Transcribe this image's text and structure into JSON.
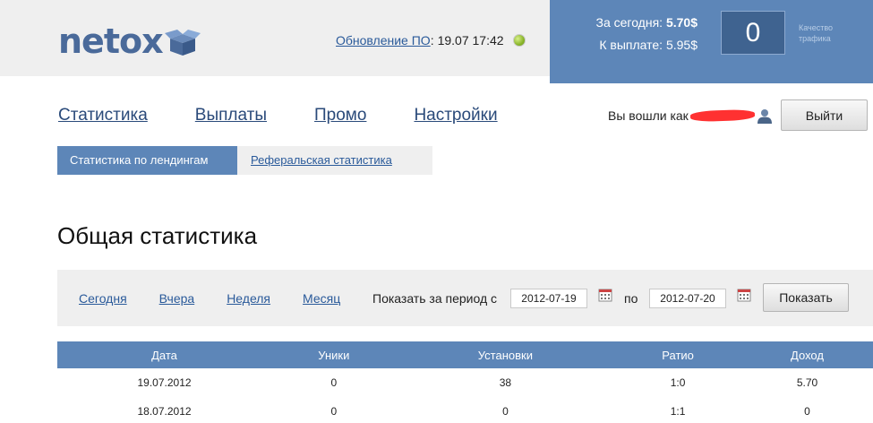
{
  "header": {
    "logo_text": "netox",
    "update_link": "Обновление ПО",
    "update_colon": ":",
    "update_time": "19.07 17:42"
  },
  "balance": {
    "today_label": "За сегодня:",
    "today_value": "5.70$",
    "payout_label": "К выплате:",
    "payout_value": "5.95$",
    "quality_value": "0",
    "quality_label": "Качество трафика"
  },
  "nav": {
    "items": [
      "Статистика",
      "Выплаты",
      "Промо",
      "Настройки"
    ]
  },
  "user": {
    "logged_in_label": "Вы вошли как",
    "logout_label": "Выйти"
  },
  "subnav": {
    "active": "Статистика по лендингам",
    "inactive": "Реферальская статистика"
  },
  "page": {
    "title": "Общая статистика"
  },
  "filter": {
    "periods": [
      "Сегодня",
      "Вчера",
      "Неделя",
      "Месяц"
    ],
    "period_label": "Показать за период с",
    "date_from": "2012-07-19",
    "to_label": "по",
    "date_to": "2012-07-20",
    "show_label": "Показать"
  },
  "table": {
    "headers": [
      "Дата",
      "Уники",
      "Установки",
      "Ратио",
      "Доход"
    ],
    "rows": [
      [
        "19.07.2012",
        "0",
        "38",
        "1:0",
        "5.70"
      ],
      [
        "18.07.2012",
        "0",
        "0",
        "1:1",
        "0"
      ]
    ]
  },
  "colors": {
    "accent": "#5d86b8",
    "accent_dark": "#3f6390",
    "link": "#2a5a9a",
    "topbar_bg": "#efefef",
    "status_ok": "#8ab52a"
  }
}
